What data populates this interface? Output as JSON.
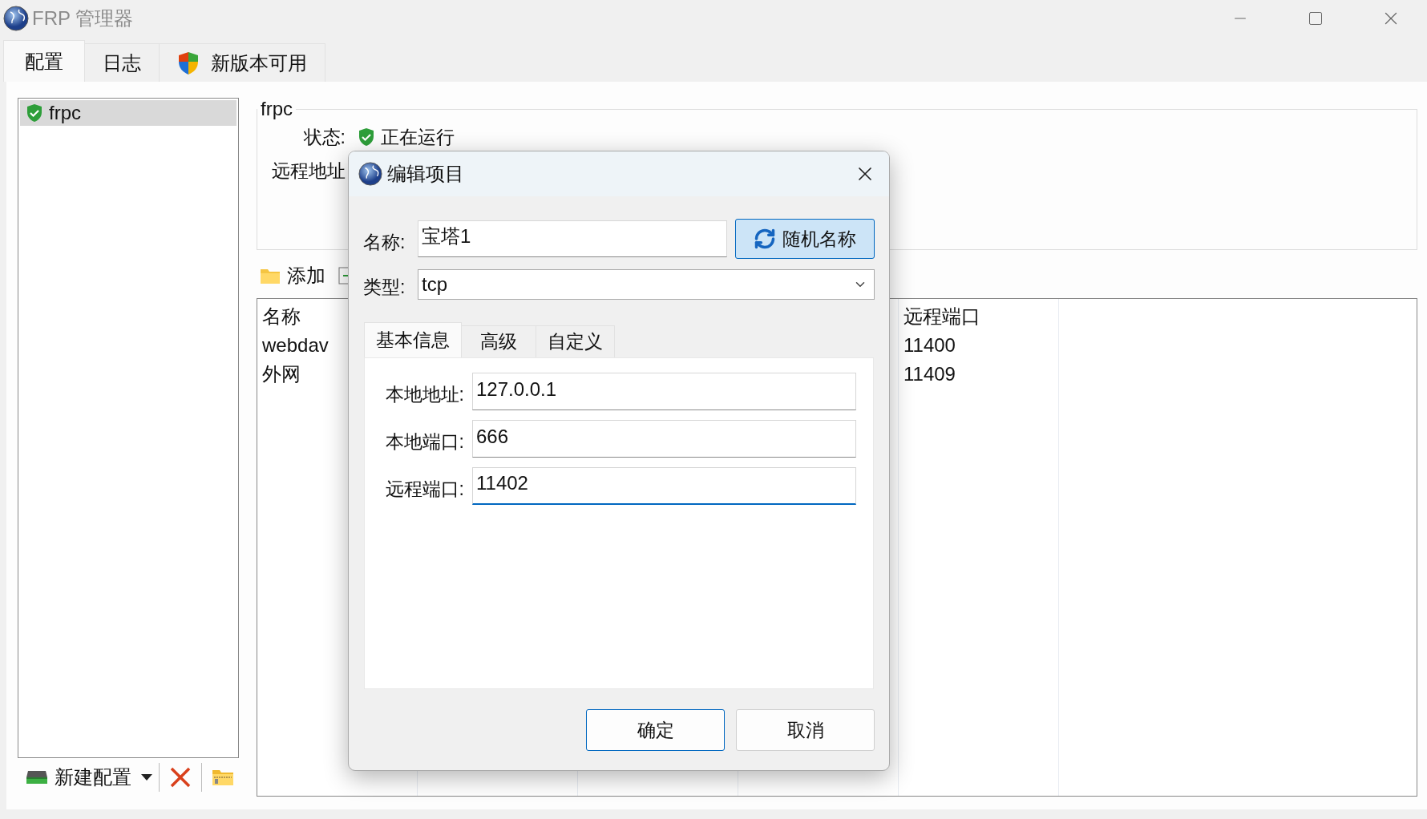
{
  "window": {
    "title": "FRP 管理器"
  },
  "tabs": [
    {
      "label": "配置",
      "selected": true,
      "kind": "plain"
    },
    {
      "label": "日志",
      "selected": false,
      "kind": "plain"
    },
    {
      "label": "新版本可用",
      "selected": false,
      "kind": "update"
    }
  ],
  "config_list": {
    "items": [
      {
        "label": "frpc",
        "selected": true
      }
    ]
  },
  "config_toolbar": {
    "new_button": "新建配置"
  },
  "details": {
    "title": "frpc",
    "rows": [
      {
        "label": "状态:",
        "value": "正在运行"
      },
      {
        "label": "远程地址"
      }
    ]
  },
  "proxy_toolbar": {
    "add_button": "添加"
  },
  "table": {
    "columns": [
      {
        "label": "名称",
        "kind": "shown"
      },
      {
        "kind": "hidden"
      },
      {
        "kind": "hidden"
      },
      {
        "kind": "hidden"
      },
      {
        "label": "远程端口",
        "kind": "shown"
      }
    ],
    "rows": [
      [
        "webdav",
        "",
        "",
        "",
        "11400"
      ],
      [
        "外网",
        "",
        "",
        "",
        "11409"
      ]
    ]
  },
  "dialog": {
    "title": "编辑项目",
    "name": {
      "label": "名称:",
      "value": "宝塔1"
    },
    "random_button": "随机名称",
    "type": {
      "label": "类型:",
      "value": "tcp"
    },
    "tabs": [
      {
        "label": "基本信息",
        "selected": true
      },
      {
        "label": "高级",
        "selected": false
      },
      {
        "label": "自定义",
        "selected": false
      }
    ],
    "fields": [
      {
        "label": "本地地址:",
        "value": "127.0.0.1",
        "focused": false
      },
      {
        "label": "本地端口:",
        "value": "666",
        "focused": false
      },
      {
        "label": "远程端口:",
        "value": "11402",
        "focused": true
      }
    ],
    "buttons": [
      {
        "label": "确定",
        "default": true
      },
      {
        "label": "取消",
        "default": false
      }
    ]
  }
}
